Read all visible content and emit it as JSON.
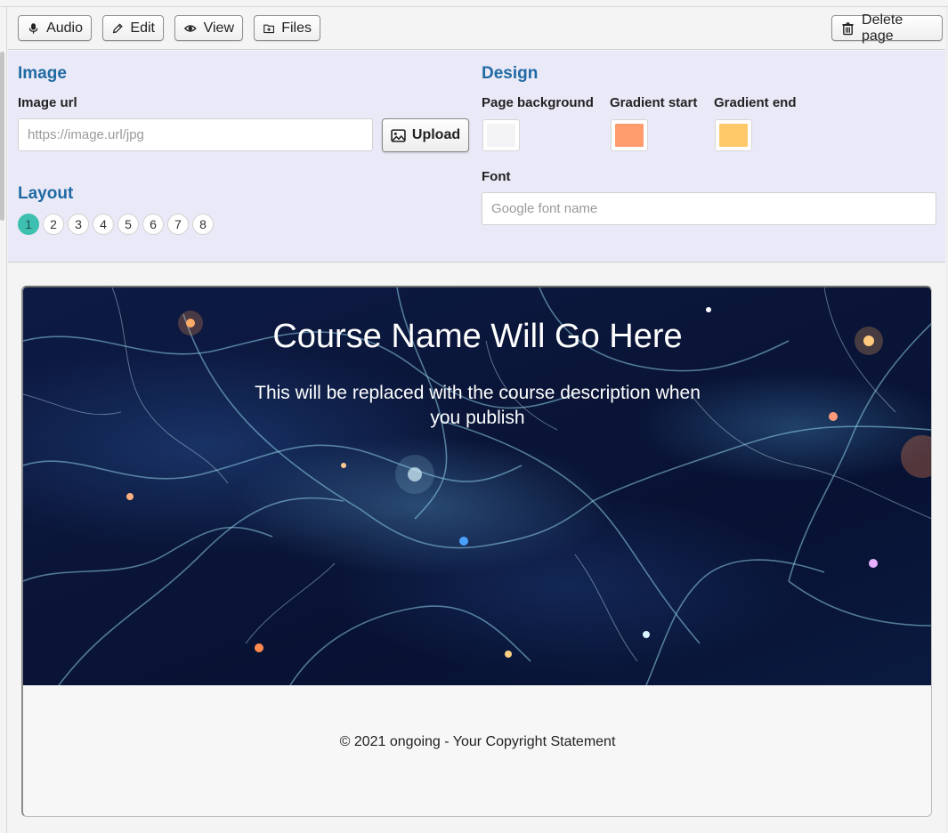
{
  "toolbar": {
    "audio_label": "Audio",
    "edit_label": "Edit",
    "view_label": "View",
    "files_label": "Files",
    "delete_label": "Delete page"
  },
  "image_section": {
    "title": "Image",
    "url_label": "Image url",
    "url_value": "",
    "url_placeholder": "https://image.url/jpg",
    "upload_label": "Upload"
  },
  "layout_section": {
    "title": "Layout",
    "options": [
      "1",
      "2",
      "3",
      "4",
      "5",
      "6",
      "7",
      "8"
    ],
    "selected": "1"
  },
  "design_section": {
    "title": "Design",
    "page_background_label": "Page background",
    "page_background_color": "#f4f4f6",
    "gradient_start_label": "Gradient start",
    "gradient_start_color": "#ff9c6e",
    "gradient_end_label": "Gradient end",
    "gradient_end_color": "#ffc96a",
    "font_label": "Font",
    "font_value": "",
    "font_placeholder": "Google font name"
  },
  "preview": {
    "course_title": "Course Name Will Go Here",
    "course_description": "This will be replaced with the course description when you publish",
    "footer": "© 2021 ongoing - Your Copyright Statement"
  },
  "colors": {
    "heading_blue": "#1f6aa3",
    "layout_active": "#3ec0b0",
    "panel_background": "#eae9f7"
  }
}
